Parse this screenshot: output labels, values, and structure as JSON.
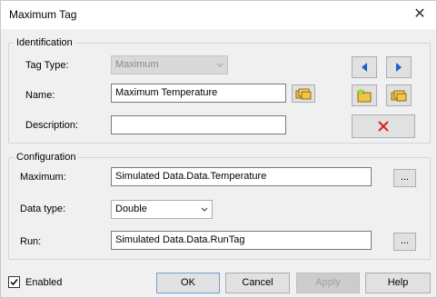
{
  "window": {
    "title": "Maximum Tag",
    "close_glyph": "✕"
  },
  "identification": {
    "legend": "Identification",
    "tag_type_label": "Tag Type:",
    "tag_type_value": "Maximum",
    "name_label": "Name:",
    "name_value": "Maximum Temperature",
    "description_label": "Description:",
    "description_value": ""
  },
  "configuration": {
    "legend": "Configuration",
    "maximum_label": "Maximum:",
    "maximum_value": "Simulated Data.Data.Temperature",
    "data_type_label": "Data type:",
    "data_type_value": "Double",
    "run_label": "Run:",
    "run_value": "Simulated Data.Data.RunTag",
    "browse_label": "..."
  },
  "footer": {
    "enabled_label": "Enabled",
    "enabled_checked": true,
    "ok_label": "OK",
    "cancel_label": "Cancel",
    "apply_label": "Apply",
    "help_label": "Help"
  },
  "icons": {
    "nav_prev": "blue-left-arrow-icon",
    "nav_next": "blue-right-arrow-icon",
    "new_tag": "new-folder-icon",
    "copy_tag": "folders-icon",
    "delete": "red-x-icon",
    "browse_name": "folders-icon"
  },
  "colors": {
    "arrow_blue": "#1f5fd0",
    "delete_red": "#e02020",
    "folder_yellow": "#f2c44a"
  }
}
